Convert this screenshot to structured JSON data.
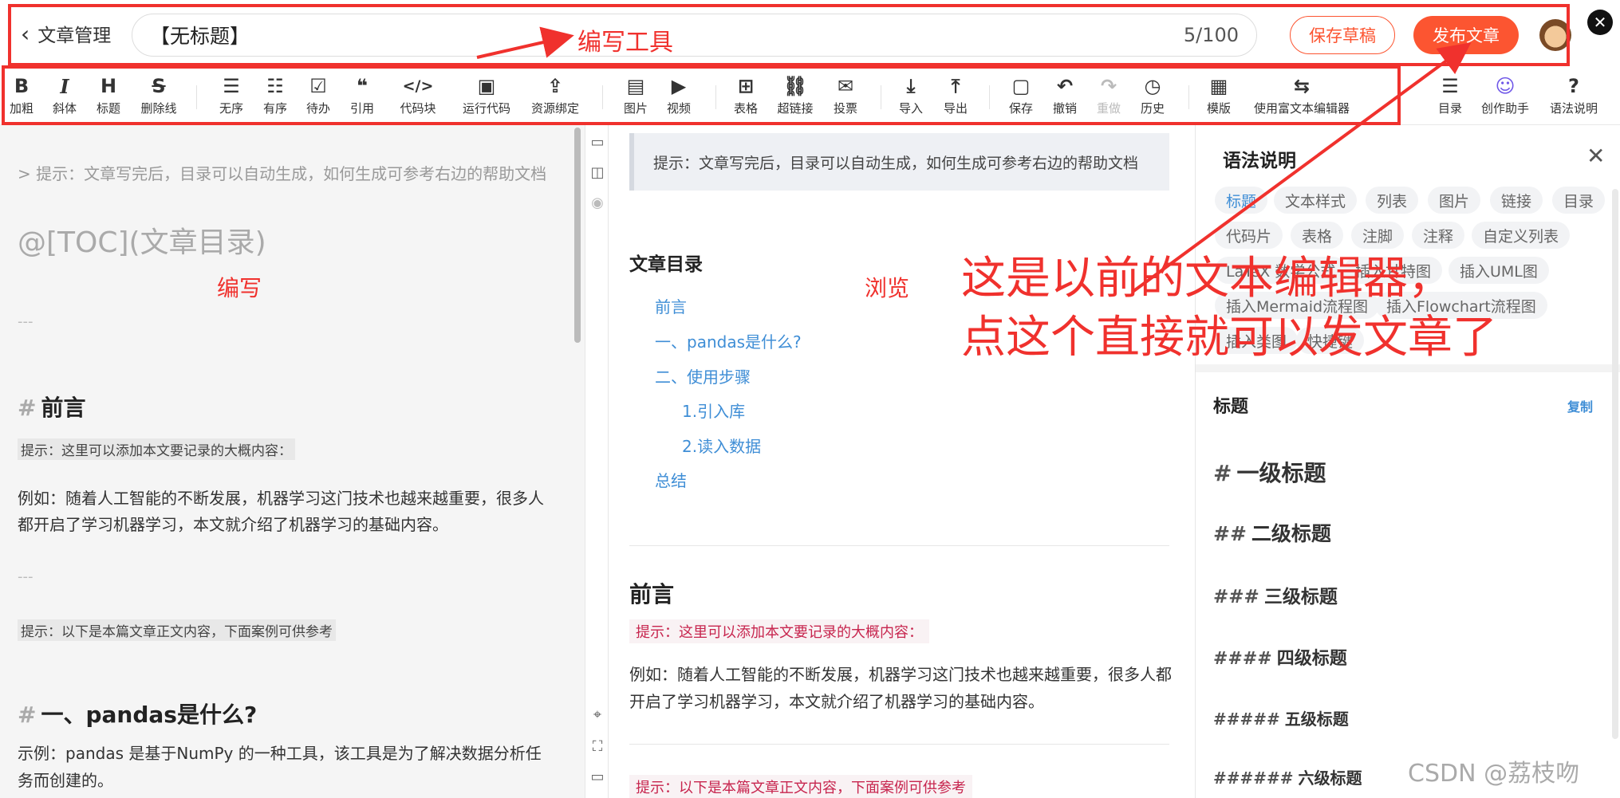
{
  "header": {
    "back_label": "文章管理",
    "title_value": "【无标题】",
    "title_count": "5/100",
    "save_draft": "保存草稿",
    "publish": "发布文章"
  },
  "toolbar": {
    "items": [
      {
        "icon": "B",
        "label": "加粗",
        "name": "bold"
      },
      {
        "icon": "I",
        "label": "斜体",
        "name": "italic"
      },
      {
        "icon": "H",
        "label": "标题",
        "name": "heading"
      },
      {
        "icon": "S",
        "label": "删除线",
        "name": "strikethrough"
      },
      {
        "icon": "☰",
        "label": "无序",
        "name": "unordered-list"
      },
      {
        "icon": "☷",
        "label": "有序",
        "name": "ordered-list"
      },
      {
        "icon": "☑",
        "label": "待办",
        "name": "todo"
      },
      {
        "icon": "❝",
        "label": "引用",
        "name": "quote"
      },
      {
        "icon": "</>",
        "label": "代码块",
        "name": "code-block"
      },
      {
        "icon": "▣",
        "label": "运行代码",
        "name": "run-code"
      },
      {
        "icon": "⇪",
        "label": "资源绑定",
        "name": "resource-bind"
      },
      {
        "icon": "▤",
        "label": "图片",
        "name": "image"
      },
      {
        "icon": "▶",
        "label": "视频",
        "name": "video"
      },
      {
        "icon": "⊞",
        "label": "表格",
        "name": "table"
      },
      {
        "icon": "⛓",
        "label": "超链接",
        "name": "hyperlink"
      },
      {
        "icon": "✉",
        "label": "投票",
        "name": "vote"
      },
      {
        "icon": "⤓",
        "label": "导入",
        "name": "import"
      },
      {
        "icon": "⤒",
        "label": "导出",
        "name": "export"
      },
      {
        "icon": "▢",
        "label": "保存",
        "name": "save"
      },
      {
        "icon": "↶",
        "label": "撤销",
        "name": "undo"
      },
      {
        "icon": "↷",
        "label": "重做",
        "name": "redo"
      },
      {
        "icon": "◷",
        "label": "历史",
        "name": "history"
      },
      {
        "icon": "▦",
        "label": "模版",
        "name": "template"
      },
      {
        "icon": "⇆",
        "label": "使用富文本编辑器",
        "name": "rich-text-editor"
      },
      {
        "icon": "☰",
        "label": "目录",
        "name": "toc"
      },
      {
        "icon": "☺",
        "label": "创作助手",
        "name": "assistant"
      },
      {
        "icon": "?",
        "label": "语法说明",
        "name": "syntax-help"
      }
    ]
  },
  "editor": {
    "hint": "> 提示：文章写完后，目录可以自动生成，如何生成可参考右边的帮助文档",
    "toc": "@[TOC](文章目录)",
    "hr1": "---",
    "h_preface_hash": "#",
    "h_preface": "前言",
    "preface_hint": "提示：这里可以添加本文要记录的大概内容：",
    "preface_p1": "例如：随着人工智能的不断发展，机器学习这门技术也越来越重要，很多人",
    "preface_p2": "都开启了学习机器学习，本文就介绍了机器学习的基础内容。",
    "hr2": "---",
    "body_hint": "提示：以下是本篇文章正文内容，下面案例可供参考",
    "h1_hash": "#",
    "h1": "一、pandas是什么?",
    "h1_p1": "示例：pandas 是基于NumPy 的一种工具，该工具是为了解决数据分析任",
    "h1_p2": "务而创建的。"
  },
  "preview": {
    "hint": "提示：文章写完后，目录可以自动生成，如何生成可参考右边的帮助文档",
    "toc_title": "文章目录",
    "toc_items": [
      "前言",
      "一、pandas是什么?",
      "二、使用步骤",
      "1.引入库",
      "2.读入数据",
      "总结"
    ],
    "preface_title": "前言",
    "preface_hint": "提示：这里可以添加本文要记录的大概内容：",
    "preface_p": "例如：随着人工智能的不断发展，机器学习这门技术也越来越重要，很多人都开启了学习机器学习，本文就介绍了机器学习的基础内容。",
    "body_hint": "提示：以下是本篇文章正文内容，下面案例可供参考"
  },
  "panel": {
    "title": "语法说明",
    "tags": [
      "标题",
      "文本样式",
      "列表",
      "图片",
      "链接",
      "目录",
      "代码片",
      "表格",
      "注脚",
      "注释",
      "自定义列表",
      "LaTeX 数学公式",
      "插入甘特图",
      "插入UML图",
      "插入Mermaid流程图",
      "插入Flowchart流程图",
      "插入类图",
      "快捷键"
    ],
    "section_title": "标题",
    "copy_label": "复制",
    "headings": [
      {
        "hash": "#",
        "text": "一级标题"
      },
      {
        "hash": "##",
        "text": "二级标题"
      },
      {
        "hash": "###",
        "text": "三级标题"
      },
      {
        "hash": "####",
        "text": "四级标题"
      },
      {
        "hash": "#####",
        "text": "五级标题"
      },
      {
        "hash": "######",
        "text": "六级标题"
      }
    ]
  },
  "annotations": {
    "tools": "编写工具",
    "write": "编写",
    "browse": "浏览",
    "big_line1": "这是以前的文本编辑器，",
    "big_line2": "点这个直接就可以发文章了",
    "color": "#f0312d"
  },
  "watermark": "CSDN @荔枝吻"
}
